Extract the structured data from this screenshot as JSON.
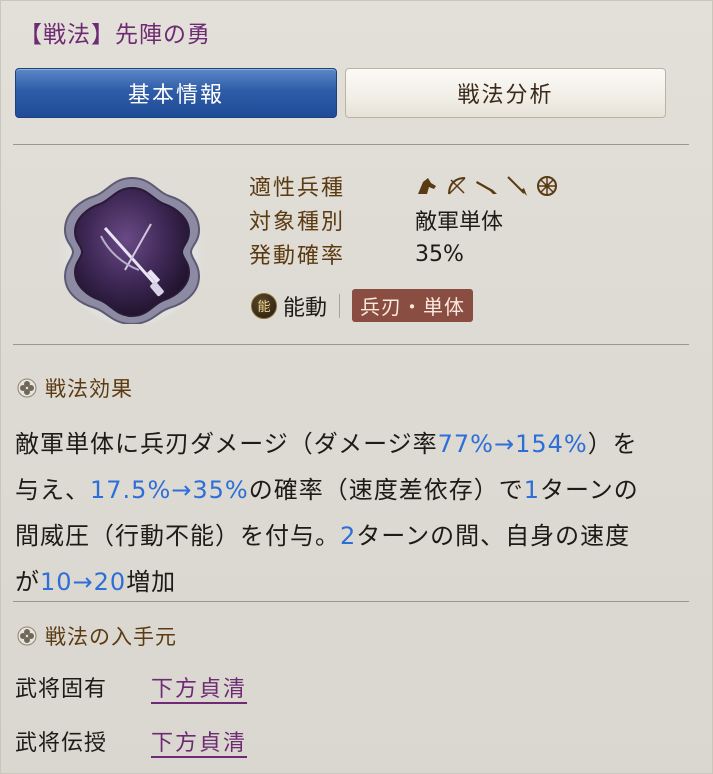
{
  "header": {
    "title": "【戦法】先陣の勇"
  },
  "tabs": [
    {
      "label": "基本情報",
      "active": true
    },
    {
      "label": "戦法分析",
      "active": false
    }
  ],
  "tactic_icon": "crossed-swords-emblem-icon",
  "stats": {
    "troop_label": "適性兵種",
    "troop_icons": [
      "cavalry-icon",
      "bow-icon",
      "gun-icon",
      "spear-icon",
      "siege-wheel-icon"
    ],
    "target_label": "対象種別",
    "target_value": "敵軍単体",
    "rate_label": "発動確率",
    "rate_value": "35%"
  },
  "tags": {
    "icon_glyph": "能",
    "type": "能動",
    "category": "兵刃・単体"
  },
  "effect": {
    "heading": "戦法効果",
    "segments": [
      {
        "text": "敵軍単体に兵刃ダメージ（ダメージ率",
        "highlight": false
      },
      {
        "text": "77%→154%",
        "highlight": true
      },
      {
        "text": "）を与え、",
        "highlight": false
      },
      {
        "text": "17.5%→35%",
        "highlight": true
      },
      {
        "text": "の確率（速度差依存）で",
        "highlight": false
      },
      {
        "text": "1",
        "highlight": true
      },
      {
        "text": "ターンの間威圧（行動不能）を付与。",
        "highlight": false
      },
      {
        "text": "2",
        "highlight": true
      },
      {
        "text": "ターンの間、自身の速度が",
        "highlight": false
      },
      {
        "text": "10→20",
        "highlight": true
      },
      {
        "text": "増加",
        "highlight": false
      }
    ]
  },
  "sources": {
    "heading": "戦法の入手元",
    "items": [
      {
        "label": "武将固有",
        "value": "下方貞清"
      },
      {
        "label": "武将伝授",
        "value": "下方貞清"
      }
    ]
  },
  "colors": {
    "title": "#6e2a73",
    "tab_active": "#2f5ca8",
    "highlight": "#2d6ed8",
    "label_brown": "#5c3b12",
    "badge": "#8a4d42"
  }
}
